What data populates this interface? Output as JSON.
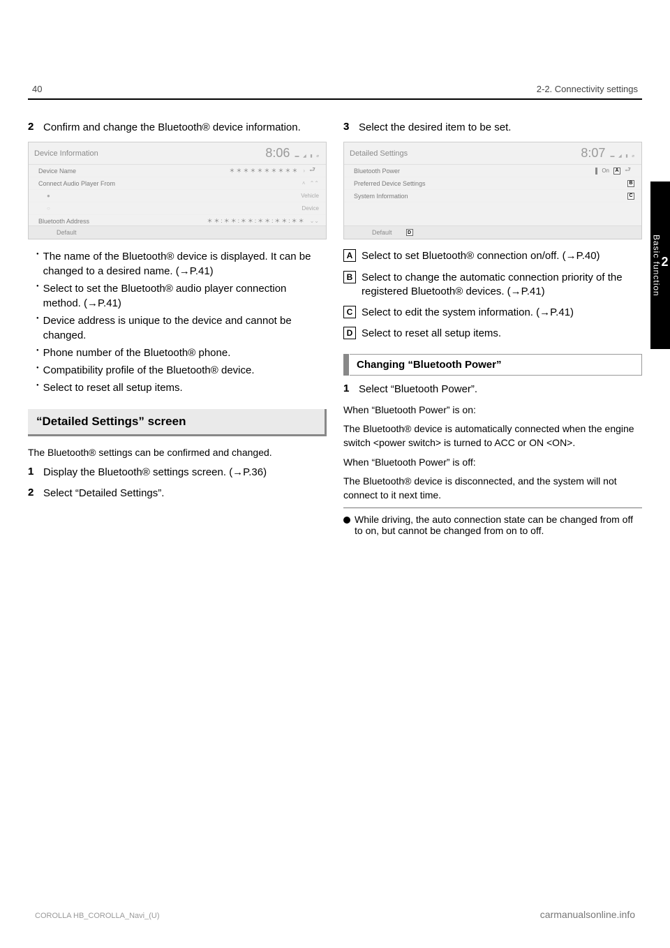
{
  "header": {
    "page_num": "40",
    "section": "2-2. Connectivity settings"
  },
  "left": {
    "step2": "Confirm and change the Bluetooth® device information.",
    "screenshot1": {
      "title": "Device Information",
      "time": "8:06",
      "rows": {
        "device_name": "Device Name",
        "device_name_val": "＊＊＊＊＊＊＊＊＊＊",
        "connect_from": "Connect Audio Player From",
        "vehicle": "Vehicle",
        "device": "Device",
        "bt_address": "Bluetooth Address",
        "bt_address_val": "＊＊:＊＊:＊＊:＊＊:＊＊:＊＊"
      },
      "default": "Default"
    },
    "notes": {
      "n1": "The name of the Bluetooth® device is displayed. It can be changed to a desired name. (→P.41)",
      "n2": "Select to set the Bluetooth® audio player connection method. (→P.41)",
      "n3": "Device address is unique to the device and cannot be changed.",
      "n4": "Phone number of the Bluetooth® phone.",
      "n5": "Compatibility profile of the Bluetooth® device.",
      "n6": "Select to reset all setup items."
    },
    "section_title": "“Detailed Settings” screen",
    "section_body": "The Bluetooth® settings can be confirmed and changed.",
    "step1b": "Display the Bluetooth® settings screen. (→P.36)",
    "step2b": "Select “Detailed Settings”."
  },
  "right": {
    "step3": "Select the desired item to be set.",
    "screenshot2": {
      "title": "Detailed Settings",
      "time": "8:07",
      "rows": {
        "bt_power": "Bluetooth Power",
        "bt_power_val": "On",
        "pref": "Preferred Device Settings",
        "sys": "System Information"
      },
      "default": "Default",
      "labels": {
        "a": "A",
        "b": "B",
        "c": "C",
        "d": "D"
      }
    },
    "letters": {
      "a": "Select to set Bluetooth® connection on/off. (→P.40)",
      "b": "Select to change the automatic connection priority of the registered Bluetooth® devices. (→P.41)",
      "c": "Select to edit the system information. (→P.41)",
      "d": "Select to reset all setup items."
    },
    "subsection_title": "Changing “Bluetooth Power”",
    "substep1": "Select “Bluetooth Power”.",
    "on_header": "When “Bluetooth Power” is on:",
    "on_body": "The Bluetooth® device is automatically connected when the engine switch <power switch> is turned to ACC or ON <ON>.",
    "off_header": "When “Bluetooth Power” is off:",
    "off_body": "The Bluetooth® device is disconnected, and the system will not connect to it next time.",
    "footnote_header": "While driving, the auto connection state can be changed from off to on, but cannot be changed from on to off."
  },
  "side_tab": {
    "num": "2",
    "label": "Basic function"
  },
  "footer": {
    "left": "COROLLA HB_COROLLA_Navi_(U)",
    "right": "carmanualsonline.info"
  },
  "page_label_small": "40"
}
